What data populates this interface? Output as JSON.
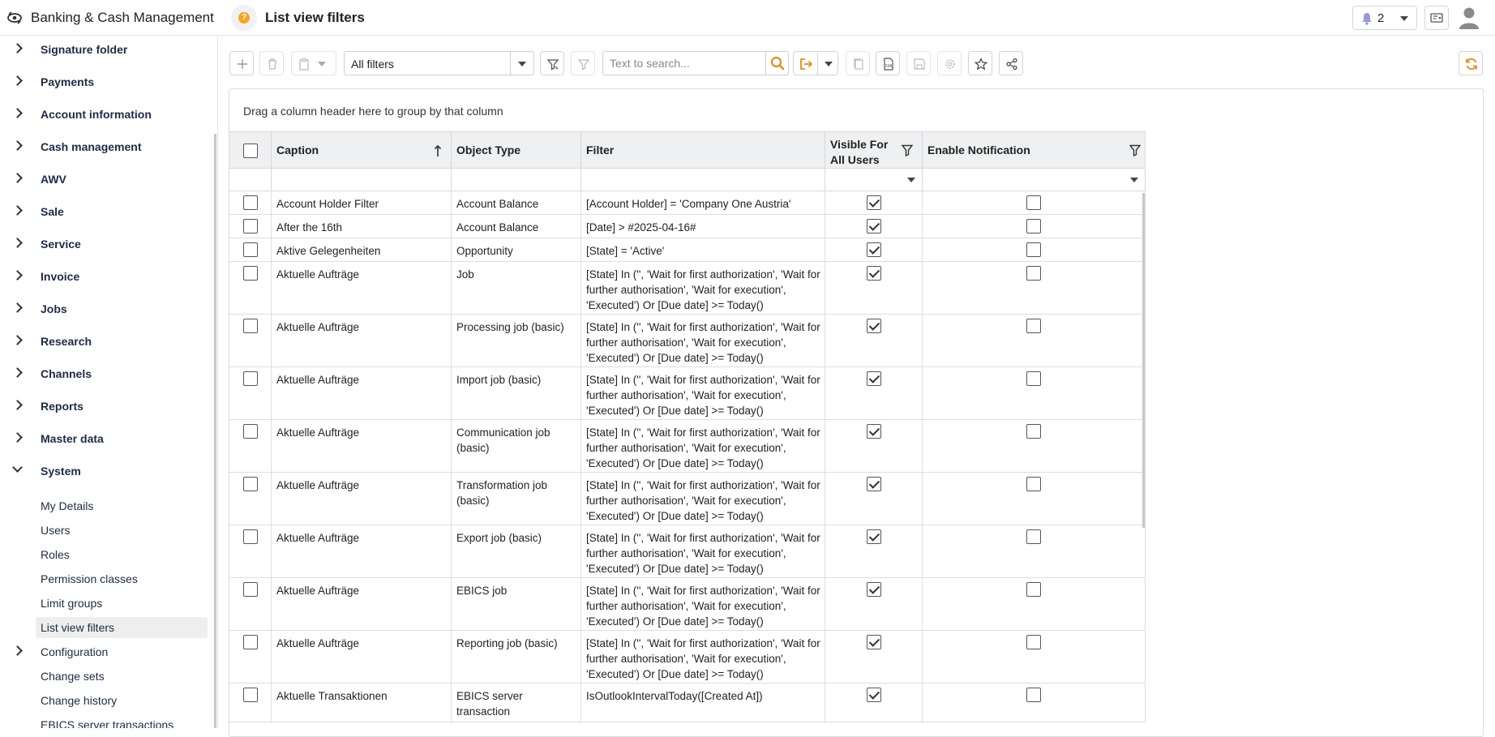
{
  "header": {
    "app_title": "Banking & Cash Management",
    "page_title": "List view filters",
    "help_badge": "?",
    "notifications_count": "2"
  },
  "sidebar": {
    "items": [
      {
        "label": "Signature folder"
      },
      {
        "label": "Payments"
      },
      {
        "label": "Account information"
      },
      {
        "label": "Cash management"
      },
      {
        "label": "AWV"
      },
      {
        "label": "Sale"
      },
      {
        "label": "Service"
      },
      {
        "label": "Invoice"
      },
      {
        "label": "Jobs"
      },
      {
        "label": "Research"
      },
      {
        "label": "Channels"
      },
      {
        "label": "Reports"
      },
      {
        "label": "Master data"
      },
      {
        "label": "System"
      }
    ],
    "system_children": [
      {
        "label": "My Details"
      },
      {
        "label": "Users"
      },
      {
        "label": "Roles"
      },
      {
        "label": "Permission classes"
      },
      {
        "label": "Limit groups"
      },
      {
        "label": "List view filters"
      },
      {
        "label": "Configuration"
      },
      {
        "label": "Change sets"
      },
      {
        "label": "Change history"
      },
      {
        "label": "EBICS server transactions"
      }
    ],
    "active_item": "List view filters"
  },
  "toolbar": {
    "filter_select_value": "All filters",
    "search_placeholder": "Text to search..."
  },
  "grid": {
    "group_hint": "Drag a column header here to group by that column",
    "columns": {
      "caption": "Caption",
      "object_type": "Object Type",
      "filter": "Filter",
      "visible_for_all_users": "Visible For All Users",
      "enable_notification": "Enable Notification"
    },
    "sort": {
      "column": "Caption",
      "direction": "ascending"
    },
    "rows": [
      {
        "caption": "Account Holder Filter",
        "object_type": "Account Balance",
        "filter": "[Account Holder] = 'Company One Austria'",
        "visible": true,
        "notify": false
      },
      {
        "caption": "After the 16th",
        "object_type": "Account Balance",
        "filter": "[Date] > #2025-04-16#",
        "visible": true,
        "notify": false
      },
      {
        "caption": "Aktive Gelegenheiten",
        "object_type": "Opportunity",
        "filter": "[State] = 'Active'",
        "visible": true,
        "notify": false
      },
      {
        "caption": "Aktuelle Aufträge",
        "object_type": "Job",
        "filter": "[State] In ('', 'Wait for first authorization', 'Wait for further authorisation', 'Wait for execution', 'Executed') Or [Due date] >= Today()",
        "visible": true,
        "notify": false
      },
      {
        "caption": "Aktuelle Aufträge",
        "object_type": "Processing job (basic)",
        "filter": "[State] In ('', 'Wait for first authorization', 'Wait for further authorisation', 'Wait for execution', 'Executed') Or [Due date] >= Today()",
        "visible": true,
        "notify": false
      },
      {
        "caption": "Aktuelle Aufträge",
        "object_type": "Import job (basic)",
        "filter": "[State] In ('', 'Wait for first authorization', 'Wait for further authorisation', 'Wait for execution', 'Executed') Or [Due date] >= Today()",
        "visible": true,
        "notify": false
      },
      {
        "caption": "Aktuelle Aufträge",
        "object_type": "Communication job (basic)",
        "filter": "[State] In ('', 'Wait for first authorization', 'Wait for further authorisation', 'Wait for execution', 'Executed') Or [Due date] >= Today()",
        "visible": true,
        "notify": false
      },
      {
        "caption": "Aktuelle Aufträge",
        "object_type": "Transformation job (basic)",
        "filter": "[State] In ('', 'Wait for first authorization', 'Wait for further authorisation', 'Wait for execution', 'Executed') Or [Due date] >= Today()",
        "visible": true,
        "notify": false
      },
      {
        "caption": "Aktuelle Aufträge",
        "object_type": "Export job (basic)",
        "filter": "[State] In ('', 'Wait for first authorization', 'Wait for further authorisation', 'Wait for execution', 'Executed') Or [Due date] >= Today()",
        "visible": true,
        "notify": false
      },
      {
        "caption": "Aktuelle Aufträge",
        "object_type": "EBICS job",
        "filter": "[State] In ('', 'Wait for first authorization', 'Wait for further authorisation', 'Wait for execution', 'Executed') Or [Due date] >= Today()",
        "visible": true,
        "notify": false
      },
      {
        "caption": "Aktuelle Aufträge",
        "object_type": "Reporting job (basic)",
        "filter": "[State] In ('', 'Wait for first authorization', 'Wait for further authorisation', 'Wait for execution', 'Executed') Or [Due date] >= Today()",
        "visible": true,
        "notify": false
      },
      {
        "caption": "Aktuelle Transaktionen",
        "object_type": "EBICS server transaction",
        "filter": "IsOutlookIntervalToday([Created At])",
        "visible": true,
        "notify": false
      }
    ]
  },
  "colors": {
    "accent": "#e98a15",
    "nav_text": "#1d2b45",
    "header_bg": "#eef0f2"
  }
}
